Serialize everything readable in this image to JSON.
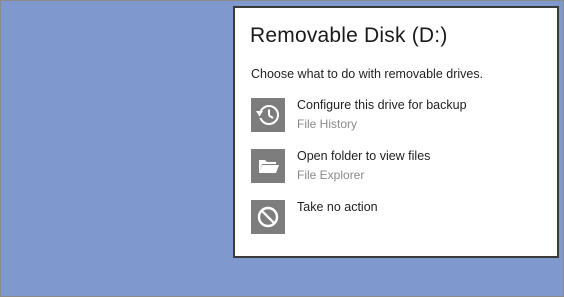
{
  "colors": {
    "desktop_background": "#7f99cf",
    "dialog_background": "#ffffff",
    "dialog_border": "#3a3a3a",
    "icon_tile": "#7d7d7d",
    "secondary_text": "#8a8a8a"
  },
  "dialog": {
    "title": "Removable Disk (D:)",
    "prompt": "Choose what to do with removable drives.",
    "options": [
      {
        "icon": "file-history-icon",
        "label": "Configure this drive for backup",
        "sublabel": "File History"
      },
      {
        "icon": "folder-open-icon",
        "label": "Open folder to view files",
        "sublabel": "File Explorer"
      },
      {
        "icon": "no-action-icon",
        "label": "Take no action",
        "sublabel": ""
      }
    ]
  }
}
